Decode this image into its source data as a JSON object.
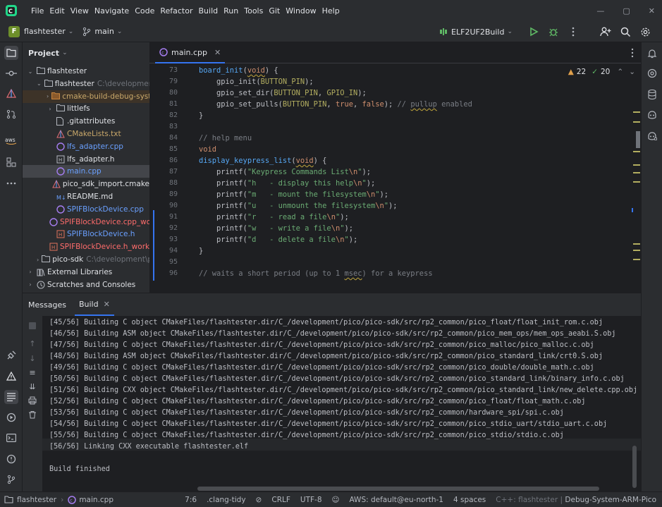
{
  "menu": [
    "File",
    "Edit",
    "View",
    "Navigate",
    "Code",
    "Refactor",
    "Build",
    "Run",
    "Tools",
    "Git",
    "Window",
    "Help"
  ],
  "toolbar": {
    "project_initial": "F",
    "project_name": "flashtester",
    "branch": "main",
    "run_config": "ELF2UF2Build"
  },
  "project_panel": {
    "title": "Project",
    "rows": [
      {
        "label": "flashtester",
        "hint": "",
        "arrow": "⌄",
        "indent": 0,
        "icon": "folder",
        "cls": "t-white"
      },
      {
        "label": "flashtester",
        "hint": "C:\\development\\",
        "arrow": "⌄",
        "indent": 1,
        "icon": "folder",
        "cls": "t-white"
      },
      {
        "label": "cmake-build-debug-syst",
        "hint": "",
        "arrow": "›",
        "indent": 2,
        "icon": "folder-orange",
        "cls": "t-cm",
        "dim": true
      },
      {
        "label": "littlefs",
        "hint": "",
        "arrow": "›",
        "indent": 2,
        "icon": "folder",
        "cls": "t-white"
      },
      {
        "label": ".gitattributes",
        "hint": "",
        "arrow": "",
        "indent": 2,
        "icon": "file",
        "cls": "t-white"
      },
      {
        "label": "CMakeLists.txt",
        "hint": "",
        "arrow": "",
        "indent": 2,
        "icon": "cmake",
        "cls": "t-cm"
      },
      {
        "label": "lfs_adapter.cpp",
        "hint": "",
        "arrow": "",
        "indent": 2,
        "icon": "cpp",
        "cls": "t-blue"
      },
      {
        "label": "lfs_adapter.h",
        "hint": "",
        "arrow": "",
        "indent": 2,
        "icon": "h",
        "cls": "t-white"
      },
      {
        "label": "main.cpp",
        "hint": "",
        "arrow": "",
        "indent": 2,
        "icon": "cpp",
        "cls": "t-blue",
        "selected": true
      },
      {
        "label": "pico_sdk_import.cmake",
        "hint": "",
        "arrow": "",
        "indent": 2,
        "icon": "cmake",
        "cls": "t-white"
      },
      {
        "label": "README.md",
        "hint": "",
        "arrow": "",
        "indent": 2,
        "icon": "md",
        "cls": "t-white"
      },
      {
        "label": "SPIFBlockDevice.cpp",
        "hint": "",
        "arrow": "",
        "indent": 2,
        "icon": "cpp",
        "cls": "t-blue"
      },
      {
        "label": "SPIFBlockDevice.cpp_wo",
        "hint": "",
        "arrow": "",
        "indent": 2,
        "icon": "cpp-red",
        "cls": "t-red"
      },
      {
        "label": "SPIFBlockDevice.h",
        "hint": "",
        "arrow": "",
        "indent": 2,
        "icon": "h-red",
        "cls": "t-blue"
      },
      {
        "label": "SPIFBlockDevice.h_worki",
        "hint": "",
        "arrow": "",
        "indent": 2,
        "icon": "h-red",
        "cls": "t-red"
      },
      {
        "label": "pico-sdk",
        "hint": "C:\\development\\p",
        "arrow": "›",
        "indent": 1,
        "icon": "folder",
        "cls": "t-white"
      },
      {
        "label": "External Libraries",
        "hint": "",
        "arrow": "›",
        "indent": 0,
        "icon": "lib",
        "cls": "t-white"
      },
      {
        "label": "Scratches and Consoles",
        "hint": "",
        "arrow": "›",
        "indent": 0,
        "icon": "scratch",
        "cls": "t-white"
      }
    ]
  },
  "editor": {
    "tab": "main.cpp",
    "warnings": "22",
    "ok": "20",
    "line_numbers": [
      "73",
      "79",
      "80",
      "81",
      "82",
      "83",
      "84",
      "85",
      "86",
      "87",
      "88",
      "89",
      "90",
      "91",
      "92",
      "93",
      "94",
      "95",
      "96"
    ],
    "lines": [
      [
        [
          "board_init",
          "fn"
        ],
        [
          "(",
          ""
        ],
        [
          "void",
          "kw wavy"
        ],
        [
          ") {",
          ""
        ]
      ],
      [
        [
          "    gpio_init(",
          ""
        ],
        [
          "BUTTON_PIN",
          "mac"
        ],
        [
          ");",
          ""
        ]
      ],
      [
        [
          "    gpio_set_dir(",
          ""
        ],
        [
          "BUTTON_PIN",
          "mac"
        ],
        [
          ", ",
          ""
        ],
        [
          "GPIO_IN",
          "mac"
        ],
        [
          ");",
          ""
        ]
      ],
      [
        [
          "    gpio_set_pulls(",
          ""
        ],
        [
          "BUTTON_PIN",
          "mac"
        ],
        [
          ", ",
          ""
        ],
        [
          "true",
          "kw"
        ],
        [
          ", ",
          ""
        ],
        [
          "false",
          "kw"
        ],
        [
          "); ",
          ""
        ],
        [
          "// ",
          "cm"
        ],
        [
          "pullup",
          "cm wavy"
        ],
        [
          " enabled",
          "cm"
        ]
      ],
      [
        [
          "}",
          ""
        ]
      ],
      [
        [
          "",
          ""
        ]
      ],
      [
        [
          "// help menu",
          "cm"
        ]
      ],
      [
        [
          "void",
          "kw"
        ]
      ],
      [
        [
          "display_keypress_list",
          "fn"
        ],
        [
          "(",
          ""
        ],
        [
          "void",
          "kw wavy"
        ],
        [
          ") {",
          ""
        ]
      ],
      [
        [
          "    printf(",
          ""
        ],
        [
          "\"Keypress Commands List",
          "str"
        ],
        [
          "\\n",
          "esc"
        ],
        [
          "\"",
          "str"
        ],
        [
          ");",
          ""
        ]
      ],
      [
        [
          "    printf(",
          ""
        ],
        [
          "\"h   - display this help",
          "str"
        ],
        [
          "\\n",
          "esc"
        ],
        [
          "\"",
          "str"
        ],
        [
          ");",
          ""
        ]
      ],
      [
        [
          "    printf(",
          ""
        ],
        [
          "\"m   - mount the filesystem",
          "str"
        ],
        [
          "\\n",
          "esc"
        ],
        [
          "\"",
          "str"
        ],
        [
          ");",
          ""
        ]
      ],
      [
        [
          "    printf(",
          ""
        ],
        [
          "\"u   - unmount the filesystem",
          "str"
        ],
        [
          "\\n",
          "esc"
        ],
        [
          "\"",
          "str"
        ],
        [
          ");",
          ""
        ]
      ],
      [
        [
          "    printf(",
          ""
        ],
        [
          "\"r   - read a file",
          "str"
        ],
        [
          "\\n",
          "esc"
        ],
        [
          "\"",
          "str"
        ],
        [
          ");",
          ""
        ]
      ],
      [
        [
          "    printf(",
          ""
        ],
        [
          "\"w   - write a file",
          "str"
        ],
        [
          "\\n",
          "esc"
        ],
        [
          "\"",
          "str"
        ],
        [
          ");",
          ""
        ]
      ],
      [
        [
          "    printf(",
          ""
        ],
        [
          "\"d   - delete a file",
          "str"
        ],
        [
          "\\n",
          "esc"
        ],
        [
          "\"",
          "str"
        ],
        [
          ");",
          ""
        ]
      ],
      [
        [
          "}",
          ""
        ]
      ],
      [
        [
          "",
          ""
        ]
      ],
      [
        [
          "// waits a short period (up to 1 ",
          "cm"
        ],
        [
          "msec",
          "cm wavy"
        ],
        [
          ") for a keypress",
          "cm"
        ]
      ]
    ]
  },
  "bottom": {
    "tab_messages": "Messages",
    "tab_build": "Build",
    "console": [
      "[45/56] Building C object CMakeFiles/flashtester.dir/C_/development/pico/pico-sdk/src/rp2_common/pico_float/float_init_rom.c.obj",
      "[46/56] Building ASM object CMakeFiles/flashtester.dir/C_/development/pico/pico-sdk/src/rp2_common/pico_mem_ops/mem_ops_aeabi.S.obj",
      "[47/56] Building C object CMakeFiles/flashtester.dir/C_/development/pico/pico-sdk/src/rp2_common/pico_malloc/pico_malloc.c.obj",
      "[48/56] Building ASM object CMakeFiles/flashtester.dir/C_/development/pico/pico-sdk/src/rp2_common/pico_standard_link/crt0.S.obj",
      "[49/56] Building C object CMakeFiles/flashtester.dir/C_/development/pico/pico-sdk/src/rp2_common/pico_double/double_math.c.obj",
      "[50/56] Building C object CMakeFiles/flashtester.dir/C_/development/pico/pico-sdk/src/rp2_common/pico_standard_link/binary_info.c.obj",
      "[51/56] Building CXX object CMakeFiles/flashtester.dir/C_/development/pico/pico-sdk/src/rp2_common/pico_standard_link/new_delete.cpp.obj",
      "[52/56] Building C object CMakeFiles/flashtester.dir/C_/development/pico/pico-sdk/src/rp2_common/pico_float/float_math.c.obj",
      "[53/56] Building C object CMakeFiles/flashtester.dir/C_/development/pico/pico-sdk/src/rp2_common/hardware_spi/spi.c.obj",
      "[54/56] Building C object CMakeFiles/flashtester.dir/C_/development/pico/pico-sdk/src/rp2_common/pico_stdio_uart/stdio_uart.c.obj",
      "[55/56] Building C object CMakeFiles/flashtester.dir/C_/development/pico/pico-sdk/src/rp2_common/pico_stdio/stdio.c.obj",
      "[56/56] Linking CXX executable flashtester.elf",
      "",
      "Build finished"
    ]
  },
  "status": {
    "crumb_project": "flashtester",
    "crumb_file": "main.cpp",
    "position": "7:6",
    "linter": ".clang-tidy",
    "line_sep": "CRLF",
    "encoding": "UTF-8",
    "aws": "AWS: default@eu-north-1",
    "indent": "4 spaces",
    "context_prefix": "C++: flashtester",
    "context_config": "Debug-System-ARM-Pico"
  }
}
